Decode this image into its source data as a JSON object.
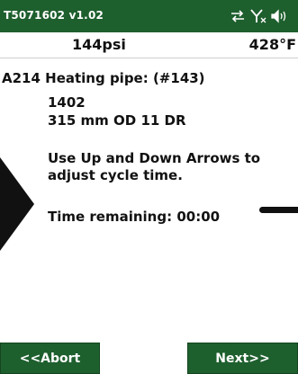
{
  "status_bar": {
    "version": "T5071602 v1.02",
    "icons": [
      "sync-arrows-icon",
      "signal-off-icon",
      "speaker-icon"
    ]
  },
  "readings": {
    "pressure": "144psi",
    "temperature": "428°F"
  },
  "job": {
    "title": "A214 Heating pipe: (#143)",
    "pipe_id": "1402",
    "pipe_size": "315 mm OD 11 DR",
    "instruction": "Use Up and Down Arrows to adjust cycle time.",
    "time_remaining_label": "Time remaining: 00:00"
  },
  "buttons": {
    "abort_label": "<<Abort",
    "next_label": "Next>>"
  },
  "colors": {
    "bar_green": "#1e5f2e",
    "text": "#111111",
    "background": "#ffffff"
  }
}
